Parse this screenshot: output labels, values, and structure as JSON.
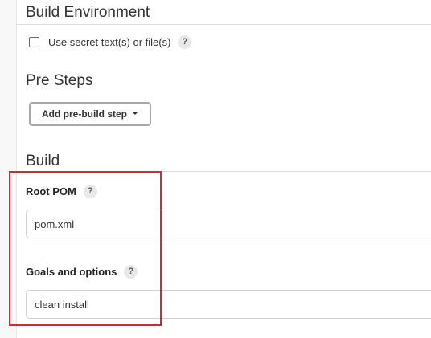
{
  "build_environment": {
    "heading": "Build Environment",
    "secret_checkbox_label": "Use secret text(s) or file(s)",
    "help_glyph": "?"
  },
  "pre_steps": {
    "heading": "Pre Steps",
    "add_button_label": "Add pre-build step"
  },
  "build": {
    "heading": "Build",
    "root_pom": {
      "label": "Root POM",
      "value": "pom.xml",
      "help_glyph": "?"
    },
    "goals": {
      "label": "Goals and options",
      "value": "clean install",
      "help_glyph": "?"
    }
  },
  "colors": {
    "highlight": "#d9262d",
    "rule": "#dcdcdc",
    "text": "#333333"
  }
}
